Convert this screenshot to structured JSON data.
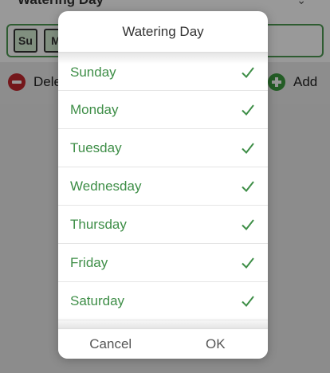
{
  "background": {
    "title": "Watering Day",
    "days": [
      "Su",
      "M"
    ],
    "delete_label": "Dele",
    "add_label": "Add"
  },
  "dialog": {
    "title": "Watering Day",
    "items": [
      {
        "label": "Sunday",
        "checked": true
      },
      {
        "label": "Monday",
        "checked": true
      },
      {
        "label": "Tuesday",
        "checked": true
      },
      {
        "label": "Wednesday",
        "checked": true
      },
      {
        "label": "Thursday",
        "checked": true
      },
      {
        "label": "Friday",
        "checked": true
      },
      {
        "label": "Saturday",
        "checked": true
      }
    ],
    "cancel_label": "Cancel",
    "ok_label": "OK"
  },
  "colors": {
    "accent": "#3e8e47",
    "delete": "#c1272d",
    "add": "#3b9a3f"
  }
}
